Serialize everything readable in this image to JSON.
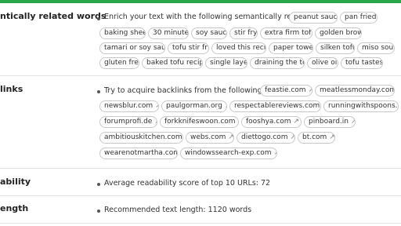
{
  "rows": {
    "semantic": {
      "label": "ntically related words",
      "intro": "Enrich your text with the following semantically related words:",
      "chips": [
        "peanut sauce",
        "pan fried",
        "baking sheet",
        "30 minutes",
        "soy sauce",
        "stir fry",
        "extra firm tofu",
        "golden brown",
        "tamari or soy sauce",
        "tofu stir fry",
        "loved this recipe",
        "paper towels",
        "silken tofu",
        "miso soup",
        "gluten free",
        "baked tofu recipe",
        "single layer",
        "draining the tofu",
        "olive oil",
        "tofu tastes"
      ]
    },
    "backlinks": {
      "label": "links",
      "intro": "Try to acquire backlinks from the following domains:",
      "domains": [
        "feastie.com",
        "meatlessmonday.com",
        "newsblur.com",
        "paulgorman.org",
        "respectablereviews.com",
        "runningwithspoons.com",
        "forumprofi.de",
        "forkknifeswoon.com",
        "fooshya.com",
        "pinboard.in",
        "ambitiouskitchen.com",
        "webs.com",
        "diettogo.com",
        "bt.com",
        "wearenotmartha.com",
        "windowssearch-exp.com"
      ]
    },
    "readability": {
      "label": "ability",
      "text": "Average readability score of top 10 URLs:  72"
    },
    "length": {
      "label": "ength",
      "text": "Recommended text length:  1120 words"
    }
  },
  "icons": {
    "external": "external-link-icon"
  },
  "colors": {
    "accent": "#2aa64b"
  }
}
